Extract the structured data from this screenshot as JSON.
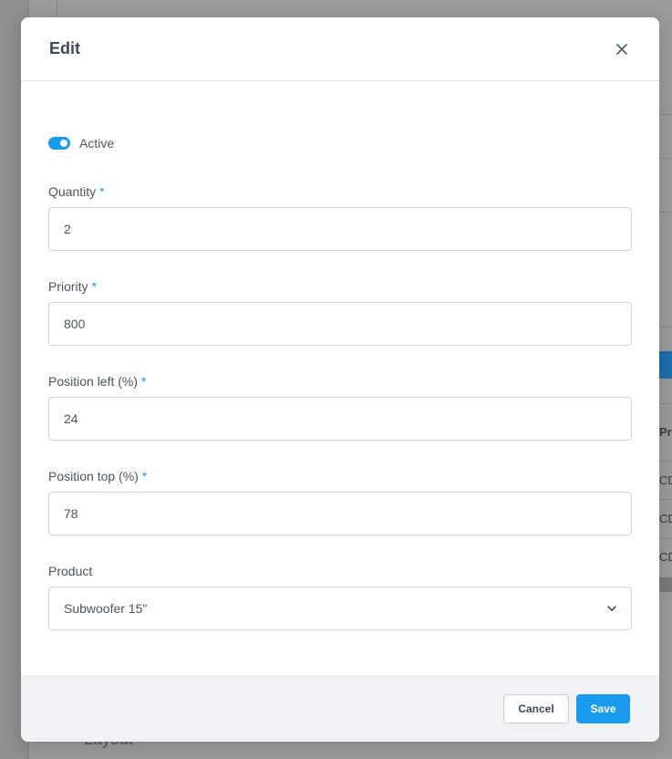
{
  "background": {
    "layout_label": "Layout",
    "table_header_fragment": "Pro",
    "table_cells": [
      "CD",
      "CD",
      "CD"
    ]
  },
  "modal": {
    "title": "Edit",
    "close_icon": "close-icon",
    "active_toggle": {
      "label": "Active",
      "checked": true,
      "color": "#1a9bf0"
    },
    "fields": {
      "quantity": {
        "label": "Quantity",
        "required": "*",
        "value": "2"
      },
      "priority": {
        "label": "Priority",
        "required": "*",
        "value": "800"
      },
      "position_left": {
        "label": "Position left (%)",
        "required": "*",
        "value": "24"
      },
      "position_top": {
        "label": "Position top (%)",
        "required": "*",
        "value": "78"
      },
      "product": {
        "label": "Product",
        "value": "Subwoofer 15\"",
        "icon": "chevron-down-icon"
      }
    },
    "footer": {
      "cancel_label": "Cancel",
      "save_label": "Save"
    }
  }
}
